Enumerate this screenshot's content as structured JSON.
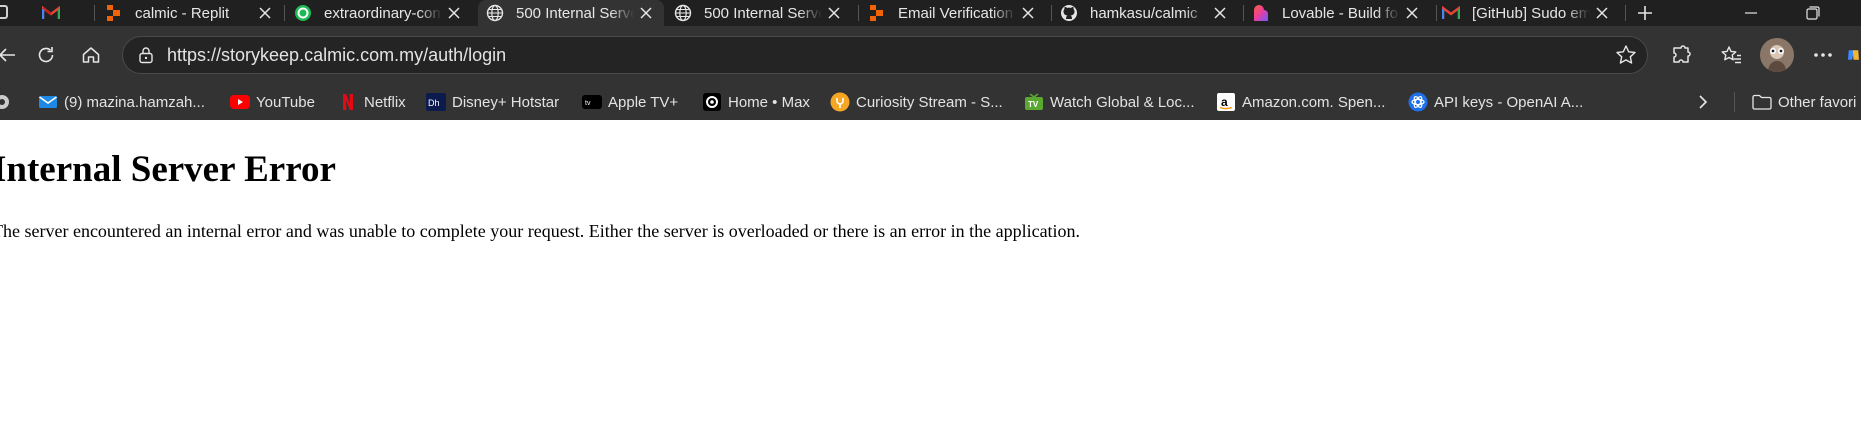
{
  "browser": {
    "tabs": [
      {
        "title": "",
        "favicon": "gmail-icon",
        "active": false
      },
      {
        "title": "calmic - Replit",
        "favicon": "replit-icon",
        "active": false
      },
      {
        "title": "extraordinary-con",
        "favicon": "spotify-icon",
        "active": false
      },
      {
        "title": "500 Internal Serve",
        "favicon": "globe-icon",
        "active": true
      },
      {
        "title": "500 Internal Serve",
        "favicon": "globe-icon",
        "active": false
      },
      {
        "title": "Email Verification",
        "favicon": "replit-icon",
        "active": false
      },
      {
        "title": "hamkasu/calmic",
        "favicon": "github-icon",
        "active": false
      },
      {
        "title": "Lovable - Build fo",
        "favicon": "lovable-icon",
        "active": false
      },
      {
        "title": "[GitHub] Sudo em",
        "favicon": "gmail-icon",
        "active": false
      }
    ],
    "address_bar": {
      "url": "https://storykeep.calmic.com.my/auth/login"
    },
    "bookmarks": [
      {
        "label": "(9) mazina.hamzah...",
        "icon": "mail-icon"
      },
      {
        "label": "YouTube",
        "icon": "youtube-icon"
      },
      {
        "label": "Netflix",
        "icon": "netflix-icon"
      },
      {
        "label": "Disney+ Hotstar",
        "icon": "hotstar-icon"
      },
      {
        "label": "Apple TV+",
        "icon": "appletv-icon"
      },
      {
        "label": "Home • Max",
        "icon": "max-icon"
      },
      {
        "label": "Curiosity Stream - S...",
        "icon": "curiosity-icon"
      },
      {
        "label": "Watch Global & Loc...",
        "icon": "tv-icon"
      },
      {
        "label": "Amazon.com. Spen...",
        "icon": "amazon-icon"
      },
      {
        "label": "API keys - OpenAI A...",
        "icon": "openai-icon"
      }
    ],
    "other_favorites_label": "Other favori"
  },
  "page": {
    "heading": "Internal Server Error",
    "message": "The server encountered an internal error and was unable to complete your request. Either the server is overloaded or there is an error in the application."
  },
  "colors": {
    "tabstrip_bg": "#202020",
    "toolbar_bg": "#333333",
    "page_bg": "#ffffff"
  }
}
